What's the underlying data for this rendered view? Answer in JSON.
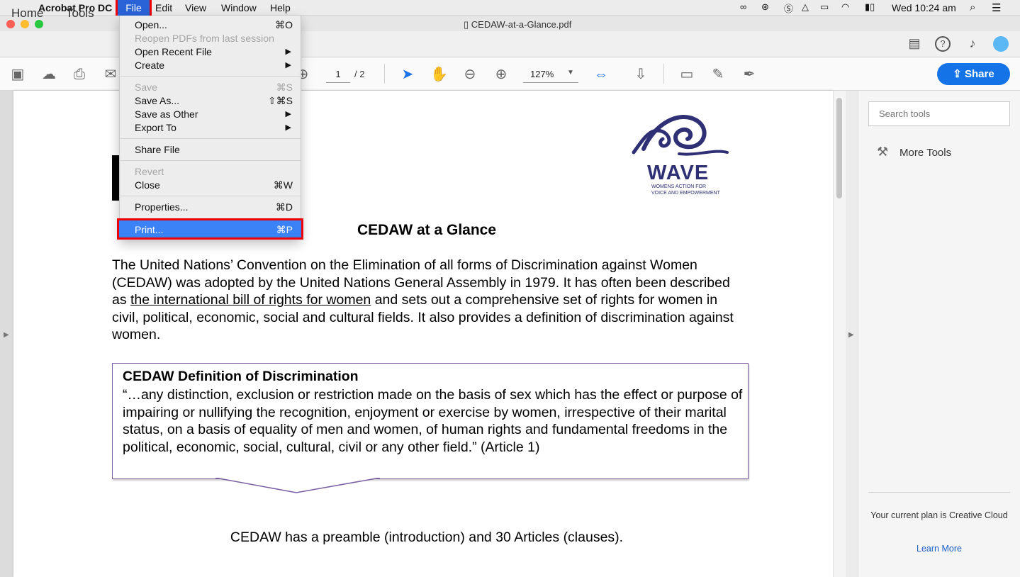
{
  "menubar": {
    "app_name": "Acrobat Pro DC",
    "menus": [
      "File",
      "Edit",
      "View",
      "Window",
      "Help"
    ],
    "clock": "Wed 10:24 am"
  },
  "window": {
    "doc_title": "CEDAW-at-a-Glance.pdf"
  },
  "tabs": {
    "home": "Home",
    "tools": "Tools"
  },
  "toolbar": {
    "page_current": "1",
    "page_total": "/ 2",
    "zoom": "127%",
    "share": "Share"
  },
  "file_menu": {
    "items": [
      {
        "label": "Open...",
        "shortcut": "⌘O",
        "enabled": true
      },
      {
        "label": "Reopen PDFs from last session",
        "shortcut": "",
        "enabled": false
      },
      {
        "label": "Open Recent File",
        "shortcut": "▶",
        "enabled": true
      },
      {
        "label": "Create",
        "shortcut": "▶",
        "enabled": true
      },
      {
        "label": "Save",
        "shortcut": "⌘S",
        "enabled": false
      },
      {
        "label": "Save As...",
        "shortcut": "⇧⌘S",
        "enabled": true
      },
      {
        "label": "Save as Other",
        "shortcut": "▶",
        "enabled": true
      },
      {
        "label": "Export To",
        "shortcut": "▶",
        "enabled": true
      },
      {
        "label": "Share File",
        "shortcut": "",
        "enabled": true
      },
      {
        "label": "Revert",
        "shortcut": "",
        "enabled": false
      },
      {
        "label": "Close",
        "shortcut": "⌘W",
        "enabled": true
      },
      {
        "label": "Properties...",
        "shortcut": "⌘D",
        "enabled": true
      },
      {
        "label": "Print...",
        "shortcut": "⌘P",
        "enabled": true,
        "highlighted": true
      }
    ]
  },
  "document": {
    "logo": {
      "name": "WAVE",
      "sub1": "WOMENS ACTION FOR",
      "sub2": "VOICE AND EMPOWERMENT"
    },
    "heading": "CEDAW at a Glance",
    "para_a": "The United Nations’ Convention on the Elimination of all forms of Discrimination against Women (CEDAW) was adopted by the United Nations General Assembly in 1979. It has often been described as ",
    "para_link": "the international bill of rights for women",
    "para_b": " and sets out a comprehensive set of rights for women in civil, political, economic, social and cultural fields. It also provides a definition of discrimination against women.",
    "callout_title": "CEDAW Definition of Discrimination",
    "callout_body": "“…any distinction, exclusion or restriction made on the basis of sex which has the effect or purpose of impairing or nullifying the recognition, enjoyment or exercise by women, irrespective of their marital status, on a basis of equality of men and women, of human rights and fundamental freedoms in the political, economic, social, cultural, civil or any other field.” (Article 1)",
    "footer": "CEDAW has a preamble (introduction) and 30 Articles (clauses)."
  },
  "right_panel": {
    "search_placeholder": "Search tools",
    "more_tools": "More Tools",
    "plan": "Your current plan is Creative Cloud",
    "learn_more": "Learn More"
  },
  "colors": {
    "accent": "#1473e6",
    "highlight_outline": "#e00000",
    "logo": "#2e2f74"
  }
}
